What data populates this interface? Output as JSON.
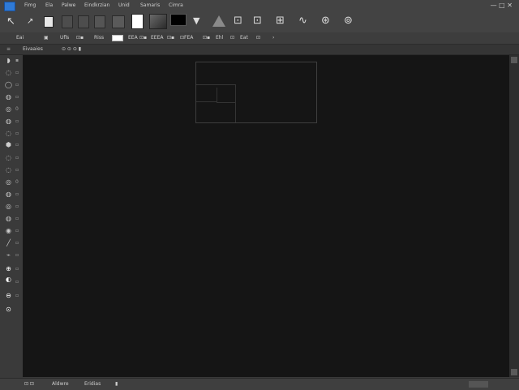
{
  "menubar": {
    "items": [
      "Fimg",
      "Ela",
      "Palwe",
      "Eindkrzian",
      "Unid",
      "Samaris",
      "Cimra"
    ],
    "window_controls": "— □ ✕"
  },
  "options": {
    "tool_glyph": "↖",
    "tool_glyph_2": "↗",
    "icon_names": [
      "move-tool-icon",
      "layer-icon",
      "swatch-icon",
      "swatch-icon",
      "swatch-icon",
      "swatch-icon",
      "white-page-icon",
      "gradient-square-icon",
      "black-swatch-icon",
      "cursor-icon",
      "triangle-icon",
      "selection-icon",
      "selection-icon",
      "crop-icon",
      "path-icon",
      "transform-icon",
      "target-icon"
    ]
  },
  "bar2": {
    "items": [
      "Eai",
      "▣",
      "Ufls",
      "⊡▪",
      "Riss",
      "EEA",
      "⊡▪",
      "EEEA",
      "⊡▪",
      "⊡FEA",
      "⊡▪",
      "Ehl",
      "⊡",
      "Eat",
      "⊡",
      "›"
    ]
  },
  "tab": {
    "label": "Eivaaies",
    "icons": "⊙  ⊙  ⊙  ▮"
  },
  "status": {
    "left_icons": "⊡  ⊡",
    "label1": "Aldwre",
    "label2": "Eridias",
    "icon": "▮"
  },
  "colors": {
    "accent": "#2f7ad6",
    "canvas": "#151515",
    "chrome": "#434343"
  }
}
